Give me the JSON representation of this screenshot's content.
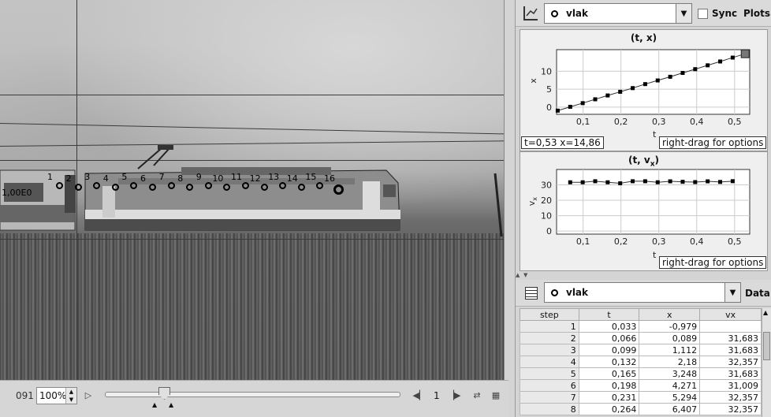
{
  "video": {
    "frame_number": "091",
    "zoom": "100%",
    "step_label": "1",
    "scale_label": "1,00E0",
    "mark_labels": [
      "1",
      "2",
      "3",
      "4",
      "5",
      "6",
      "7",
      "8",
      "9",
      "10",
      "11",
      "12",
      "13",
      "14",
      "15",
      "16"
    ],
    "slider_fraction": 0.2
  },
  "plots": {
    "track_name": "vlak",
    "sync_label": "Sync",
    "plots_label": "Plots",
    "plot1": {
      "title": "(t, x)",
      "ylabel": "x",
      "xlabel": "t",
      "readout": "t=0,53  x=14,86",
      "options_hint": "right-drag for options",
      "xticks": [
        "0,1",
        "0,2",
        "0,3",
        "0,4",
        "0,5"
      ],
      "yticks": [
        "0",
        "5",
        "10"
      ]
    },
    "plot2": {
      "title_main": "(t, v",
      "title_sub": "x",
      "title_end": ")",
      "ylabel_main": "v",
      "ylabel_sub": "x",
      "xlabel": "t",
      "options_hint": "right-drag for options",
      "xticks": [
        "0,1",
        "0,2",
        "0,3",
        "0,4",
        "0,5"
      ],
      "yticks": [
        "0",
        "10",
        "20",
        "30"
      ]
    }
  },
  "chart_data": [
    {
      "type": "scatter",
      "title": "(t, x)",
      "xlabel": "t",
      "ylabel": "x",
      "xlim": [
        0.03,
        0.54
      ],
      "ylim": [
        -2,
        16
      ],
      "x": [
        0.033,
        0.066,
        0.099,
        0.132,
        0.165,
        0.198,
        0.231,
        0.264,
        0.297,
        0.33,
        0.363,
        0.396,
        0.429,
        0.462,
        0.495,
        0.528
      ],
      "y": [
        -0.979,
        0.089,
        1.112,
        2.18,
        3.248,
        4.271,
        5.294,
        6.407,
        7.43,
        8.45,
        9.52,
        10.57,
        11.64,
        12.71,
        13.79,
        14.86
      ]
    },
    {
      "type": "scatter",
      "title": "(t, vx)",
      "xlabel": "t",
      "ylabel": "vx",
      "xlim": [
        0.03,
        0.54
      ],
      "ylim": [
        -2,
        40
      ],
      "x": [
        0.066,
        0.099,
        0.132,
        0.165,
        0.198,
        0.231,
        0.264,
        0.297,
        0.33,
        0.363,
        0.396,
        0.429,
        0.462,
        0.495
      ],
      "y": [
        31.683,
        31.683,
        32.357,
        31.683,
        31.009,
        32.357,
        32.357,
        31.7,
        32.3,
        32.0,
        31.8,
        32.3,
        31.9,
        32.4
      ]
    }
  ],
  "table": {
    "track_name": "vlak",
    "data_label": "Data",
    "columns": [
      "step",
      "t",
      "x",
      "vx"
    ],
    "rows": [
      [
        "1",
        "0,033",
        "-0,979",
        ""
      ],
      [
        "2",
        "0,066",
        "0,089",
        "31,683"
      ],
      [
        "3",
        "0,099",
        "1,112",
        "31,683"
      ],
      [
        "4",
        "0,132",
        "2,18",
        "32,357"
      ],
      [
        "5",
        "0,165",
        "3,248",
        "31,683"
      ],
      [
        "6",
        "0,198",
        "4,271",
        "31,009"
      ],
      [
        "7",
        "0,231",
        "5,294",
        "32,357"
      ],
      [
        "8",
        "0,264",
        "6,407",
        "32,357"
      ]
    ]
  }
}
